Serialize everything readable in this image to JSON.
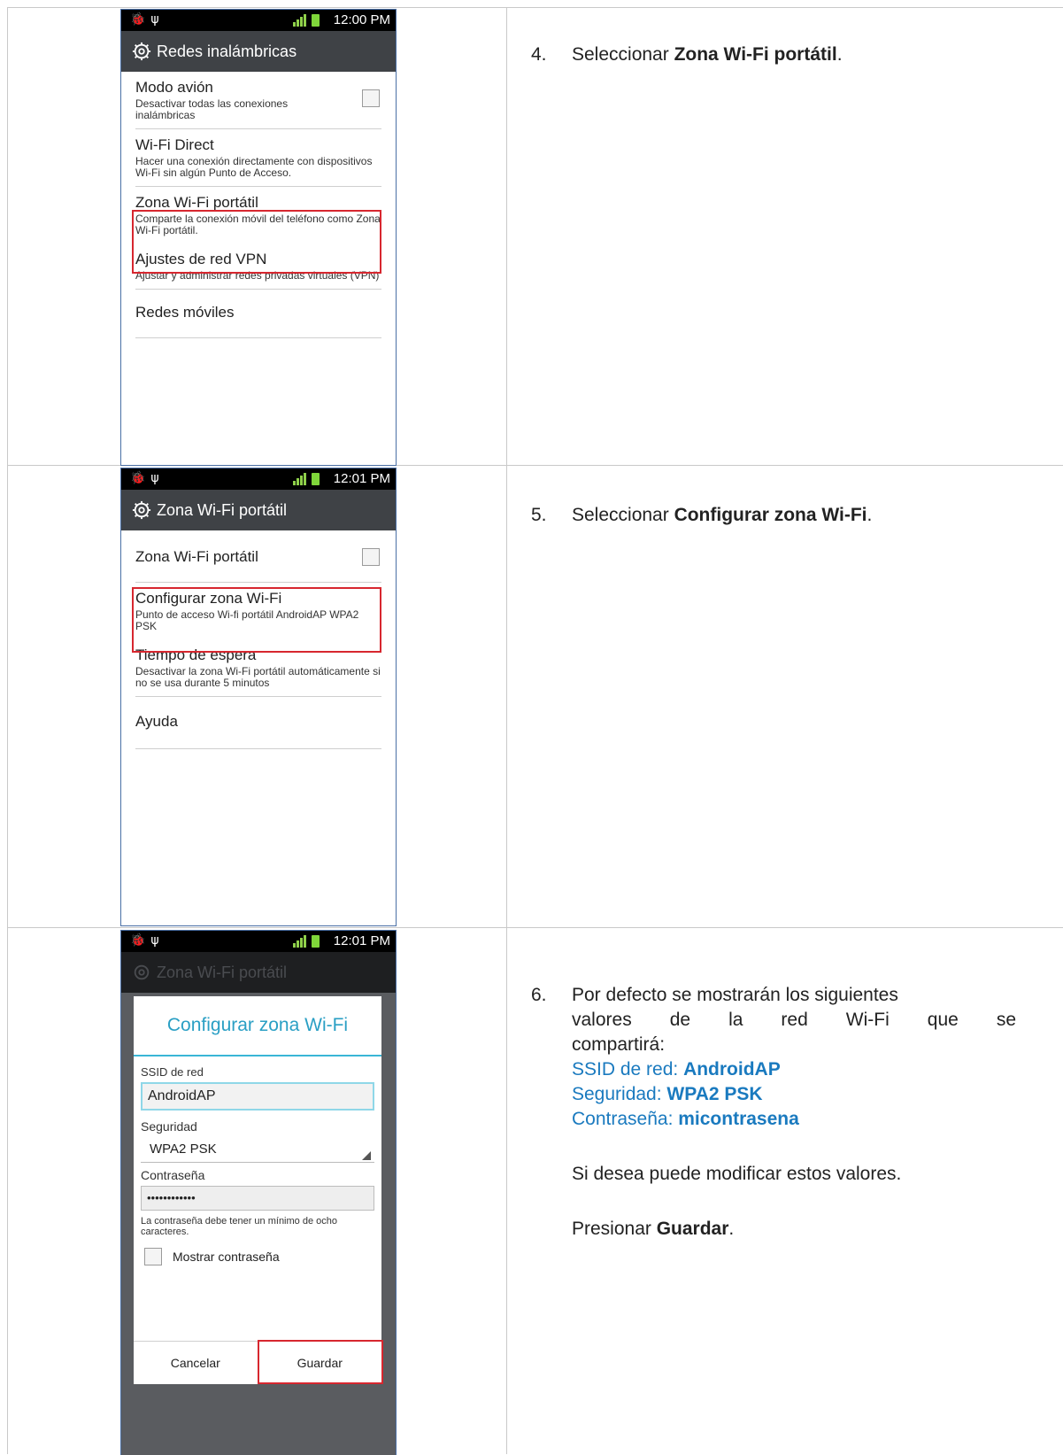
{
  "status_bars": [
    {
      "time": "12:00 PM",
      "network": "H"
    },
    {
      "time": "12:01 PM",
      "network": "3G"
    },
    {
      "time": "12:01 PM",
      "network": "3G"
    }
  ],
  "screen1": {
    "title": "Redes inalámbricas",
    "items": [
      {
        "title": "Modo avión",
        "subtitle": "Desactivar todas las conexiones inalámbricas"
      },
      {
        "title": "Wi-Fi Direct",
        "subtitle": "Hacer una conexión directamente con dispositivos Wi-Fi sin algún Punto de Acceso."
      },
      {
        "title": "Zona Wi-Fi portátil",
        "subtitle": "Comparte la conexión móvil del teléfono como Zona Wi-Fi portátil."
      },
      {
        "title": "Ajustes de red VPN",
        "subtitle": "Ajustar y administrar redes privadas virtuales (VPN)"
      },
      {
        "title": "Redes móviles",
        "subtitle": ""
      }
    ]
  },
  "screen2": {
    "title": "Zona Wi-Fi portátil",
    "items": [
      {
        "title": "Zona Wi-Fi portátil",
        "subtitle": ""
      },
      {
        "title": "Configurar zona Wi-Fi",
        "subtitle": "Punto de acceso Wi-fi portátil AndroidAP WPA2 PSK"
      },
      {
        "title": "Tiempo de espera",
        "subtitle": "Desactivar la zona Wi-Fi portátil automáticamente si no se usa durante 5 minutos"
      },
      {
        "title": "Ayuda",
        "subtitle": ""
      }
    ]
  },
  "screen3": {
    "title": "Zona Wi-Fi portátil",
    "dialog": {
      "title": "Configurar zona Wi-Fi",
      "ssid_label": "SSID de red",
      "ssid_value": "AndroidAP",
      "security_label": "Seguridad",
      "security_value": "WPA2 PSK",
      "password_label": "Contraseña",
      "password_value": "••••••••••••",
      "password_hint": "La contraseña debe tener un mínimo de ocho caracteres.",
      "show_password_label": "Mostrar contraseña",
      "cancel_label": "Cancelar",
      "save_label": "Guardar"
    }
  },
  "steps": {
    "step4": {
      "num": "4.",
      "prefix": "Seleccionar ",
      "bold": "Zona Wi-Fi portátil",
      "suffix": "."
    },
    "step5": {
      "num": "5.",
      "prefix": "Seleccionar ",
      "bold": "Configurar zona Wi-Fi",
      "suffix": "."
    },
    "step6": {
      "num": "6.",
      "line1": "Por defecto se mostrarán los siguientes",
      "line2a": "valores",
      "line2b": "de",
      "line2c": "la",
      "line2d": "red",
      "line2e": "Wi-Fi",
      "line2f": "que",
      "line2g": "se",
      "line3": "compartirá:",
      "ssid_label": "SSID de red: ",
      "ssid_value": "AndroidAP",
      "security_label": "Seguridad: ",
      "security_value": "WPA2 PSK",
      "password_label": "Contraseña: ",
      "password_value": "micontrasena",
      "modify": "Si desea puede modificar estos valores.",
      "press_prefix": "Presionar ",
      "press_bold": "Guardar",
      "press_suffix": "."
    }
  },
  "colors": {
    "highlight": "#d7272f",
    "accent": "#3ab6d6",
    "info_blue": "#1a7abf"
  }
}
